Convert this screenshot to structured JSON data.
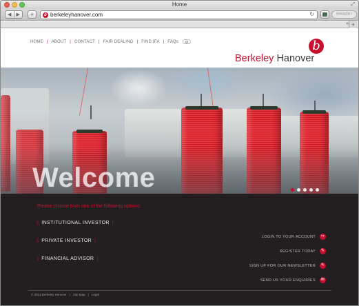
{
  "window": {
    "title": "Home"
  },
  "browser": {
    "url": "berkeleyhanover.com",
    "reader_label": "Reader",
    "back_icon": "chevron-left-icon",
    "forward_icon": "chevron-right-icon",
    "add_icon": "plus-icon"
  },
  "site": {
    "nav": [
      "HOME",
      "ABOUT",
      "CONTACT",
      "FAIR DEALING",
      "FIND IFA",
      "FAQs"
    ],
    "logo": {
      "mark": "b",
      "word1": "Berkeley",
      "word2": "Hanover"
    },
    "accent": "#c8102e",
    "dark_bg": "#231f20"
  },
  "hero": {
    "welcome": "Welcome"
  },
  "panel": {
    "prompt": "Please choose from one of the following options:",
    "investors": [
      "INSTITUTIONAL INVESTOR",
      "PRIVATE INVESTOR",
      "FINANCIAL ADVISOR"
    ],
    "actions": [
      {
        "label": "LOGIN TO YOUR ACCOUNT",
        "icon": "login-icon",
        "glyph": "↪"
      },
      {
        "label": "REGISTER TODAY",
        "icon": "register-icon",
        "glyph": "✎"
      },
      {
        "label": "SIGN UP FOR OUR NEWSLETTER",
        "icon": "newsletter-icon",
        "glyph": "✎"
      },
      {
        "label": "SEND US YOUR ENQUIRIES",
        "icon": "enquiry-icon",
        "glyph": "✉"
      }
    ]
  },
  "footer": {
    "copyright": "© 2013 Berkeley Hanover",
    "sitemap": "Site Map",
    "legal": "Legal"
  }
}
